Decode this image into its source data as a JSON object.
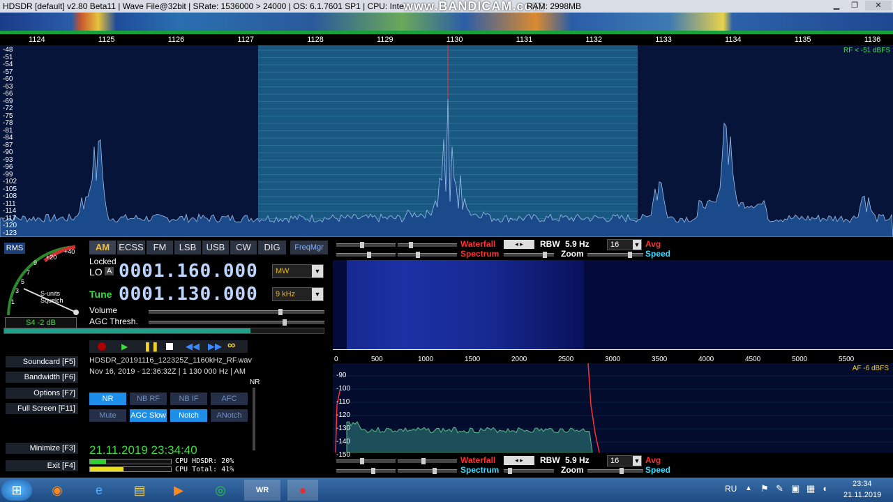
{
  "titlebar": {
    "text": "HDSDR  [default]  v2.80 Beta11  |  Wave File@32bit  |  SRate: 1536000 > 24000  |  OS: 6.1.7601 SP1  |  CPU: Intel",
    "watermark": "www.BANDICAM.com",
    "right_text": "RAM: 2998MB",
    "minimize": "▁",
    "maximize": "❐",
    "close": "✕"
  },
  "freq_scale": [
    "1124",
    "1125",
    "1126",
    "1127",
    "1128",
    "1129",
    "1130",
    "1131",
    "1132",
    "1133",
    "1134",
    "1135",
    "1136"
  ],
  "spectrum": {
    "y_labels": [
      "-48",
      "-51",
      "-54",
      "-57",
      "-60",
      "-63",
      "-66",
      "-69",
      "-72",
      "-75",
      "-78",
      "-81",
      "-84",
      "-87",
      "-90",
      "-93",
      "-96",
      "-99",
      "-102",
      "-105",
      "-108",
      "-111",
      "-114",
      "-117",
      "-120",
      "-123"
    ],
    "rf_label": "RF < -51 dBFS"
  },
  "meter": {
    "rms": "RMS",
    "s_units": "S-units",
    "squelch": "Squelch",
    "reading": "S4 -2 dB",
    "scale": [
      "+40",
      "+20",
      "9",
      "7",
      "5",
      "3",
      "1"
    ]
  },
  "modes": [
    "AM",
    "ECSS",
    "FM",
    "LSB",
    "USB",
    "CW",
    "DIG"
  ],
  "freqmgr": "FreqMgr",
  "lo": {
    "locked": "Locked",
    "label": "LO",
    "a": "A",
    "value": "0001.160.000",
    "band": "MW"
  },
  "tune": {
    "label": "Tune",
    "value": "0001.130.000",
    "step": "9 kHz"
  },
  "volume_label": "Volume",
  "agc_label": "AGC Thresh.",
  "side_buttons": [
    "Soundcard  [F5]",
    "Bandwidth  [F6]",
    "Options  [F7]",
    "Full Screen  [F11]",
    "Minimize  [F3]",
    "Exit  [F4]"
  ],
  "file": {
    "name": "HDSDR_20191116_122325Z_1160kHz_RF.wav",
    "info": "Nov 16, 2019 - 12:36:32Z | 1 130 000 Hz | AM"
  },
  "nr_label": "NR",
  "dsp_buttons": [
    "NR",
    "NB RF",
    "NB IF",
    "AFC",
    "Mute",
    "AGC Slow",
    "Notch",
    "ANotch"
  ],
  "clock": "21.11.2019 23:34:40",
  "cpu": {
    "hdsdr": "CPU HDSDR: 20%",
    "total": "CPU Total: 41%",
    "hdsdr_level": 0.2,
    "total_level": 0.41
  },
  "wf_top": {
    "waterfall": "Waterfall",
    "spectrum": "Spectrum",
    "rbw": "RBW",
    "rbw_val": "5.9 Hz",
    "zoom": "Zoom",
    "avg_val": "16",
    "avg": "Avg",
    "speed": "Speed"
  },
  "wf_bottom": {
    "waterfall": "Waterfall",
    "spectrum": "Spectrum",
    "rbw": "RBW",
    "rbw_val": "5.9 Hz",
    "zoom": "Zoom",
    "avg_val": "16",
    "avg": "Avg",
    "speed": "Speed"
  },
  "af_scale": [
    "0",
    "500",
    "1000",
    "1500",
    "2000",
    "2500",
    "3000",
    "3500",
    "4000",
    "4500",
    "5000",
    "5500"
  ],
  "af_y": [
    "-90",
    "-100",
    "-110",
    "-120",
    "-130",
    "-140",
    "-150"
  ],
  "af_label": "AF  -6 dBFS",
  "taskbar": {
    "lang": "RU",
    "time": "23:34",
    "date": "21.11.2019"
  },
  "colors": {
    "accent": "#1e90ff",
    "spectrum_bg": "#07143a",
    "passband": "#1f6f9a",
    "red": "#ff3030",
    "cyan": "#3cdcff"
  }
}
